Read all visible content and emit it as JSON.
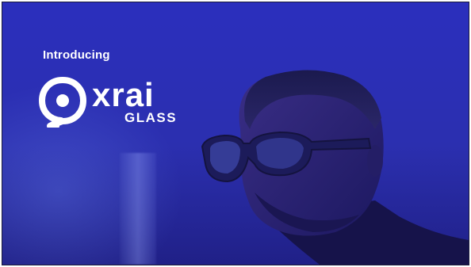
{
  "slide": {
    "intro_text": "Introducing",
    "brand": {
      "name": "xrai",
      "sub": "GLASS"
    }
  },
  "colors": {
    "background": "#2b2fb3",
    "text": "#ffffff"
  },
  "icons": {
    "logo": "xrai-speech-bubble-logo-icon"
  }
}
